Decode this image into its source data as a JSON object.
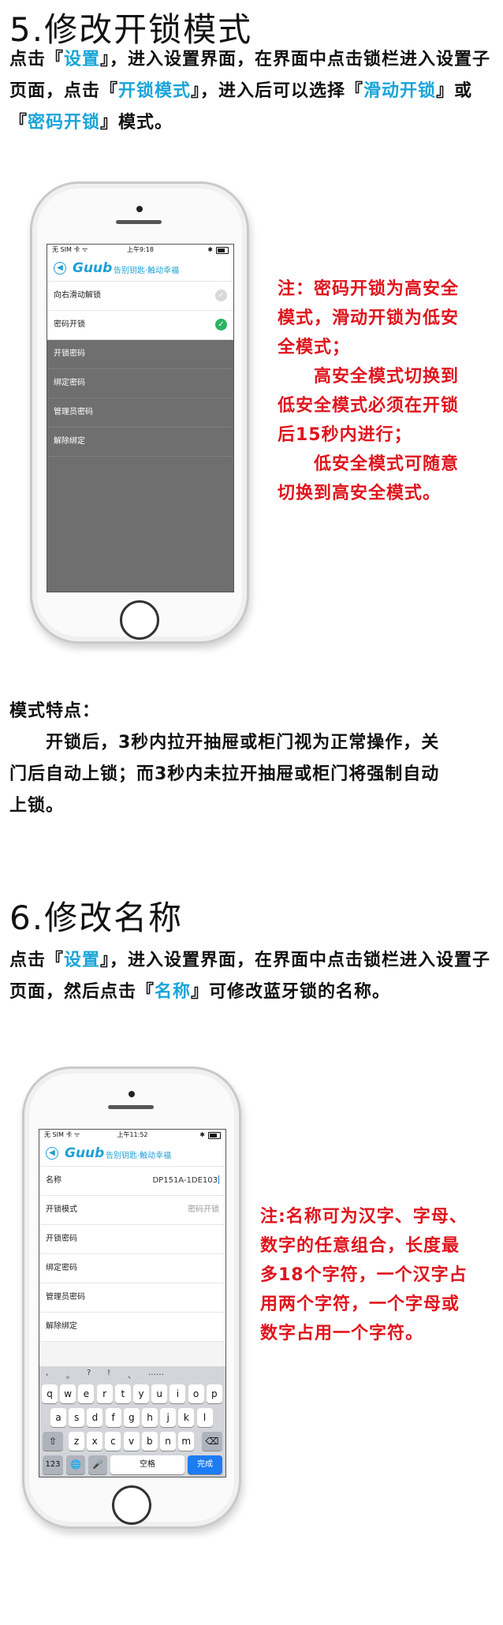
{
  "section5": {
    "heading": "5.修改开锁模式",
    "intro": [
      {
        "t": "点击『",
        "c": ""
      },
      {
        "t": "设置",
        "c": "blue"
      },
      {
        "t": "』，进入设置界面，在界面中点击锁栏进入设置子页面，点击『",
        "c": ""
      },
      {
        "t": "开锁模式",
        "c": "blue"
      },
      {
        "t": "』，进入后可以选择『",
        "c": ""
      },
      {
        "t": "滑动开锁",
        "c": "blue"
      },
      {
        "t": "』或『",
        "c": ""
      },
      {
        "t": "密码开锁",
        "c": "blue"
      },
      {
        "t": "』模式。",
        "c": ""
      }
    ],
    "note_lines": [
      "注：密码开锁为高安全",
      "模式，滑动开锁为低安",
      "全模式；",
      "　　高安全模式切换到",
      "低安全模式必须在开锁",
      "后15秒内进行；",
      "　　低安全模式可随意",
      "切换到高安全模式。"
    ],
    "features_title": "模式特点：",
    "features_lines": [
      "　　开锁后，3秒内拉开抽屉或柜门视为正常操作，关",
      "门后自动上锁；而3秒内未拉开抽屉或柜门将强制自动",
      "上锁。"
    ]
  },
  "phone1": {
    "carrier": "无 SIM 卡 ᯤ",
    "time": "上午9:18",
    "bt": "✱",
    "logo": "Guub",
    "slogan": "告别钥匙·触动幸福",
    "rows": [
      {
        "label": "向右滑动解锁",
        "checked": false
      },
      {
        "label": "密码开锁",
        "checked": true
      }
    ],
    "menu": [
      "开锁密码",
      "绑定密码",
      "管理员密码",
      "解除绑定"
    ]
  },
  "section6": {
    "heading": "6.修改名称",
    "intro": [
      {
        "t": "点击『",
        "c": ""
      },
      {
        "t": "设置",
        "c": "blue"
      },
      {
        "t": "』，进入设置界面，在界面中点击锁栏进入设置子页面，然后点击『",
        "c": ""
      },
      {
        "t": "名称",
        "c": "blue"
      },
      {
        "t": "』可修改蓝牙锁的名称。",
        "c": ""
      }
    ],
    "note_lines": [
      "注:名称可为汉字、字母、",
      "数字的任意组合，长度最",
      "多18个字符，一个汉字占",
      "用两个字符，一个字母或",
      "数字占用一个字符。"
    ]
  },
  "phone2": {
    "carrier": "无 SIM 卡 ᯤ",
    "time": "上午11:52",
    "bt": "✱",
    "logo": "Guub",
    "slogan": "告别钥匙·触动幸福",
    "name_label": "名称",
    "name_value": "DP151A-1DE103",
    "mode_label": "开锁模式",
    "mode_value": "密码开锁",
    "menu": [
      "开锁密码",
      "绑定密码",
      "管理员密码",
      "解除绑定"
    ],
    "suggestions": [
      ",",
      "。",
      "?",
      "!",
      "、",
      "……"
    ],
    "keys_row1": [
      "q",
      "w",
      "e",
      "r",
      "t",
      "y",
      "u",
      "i",
      "o",
      "p"
    ],
    "keys_row2": [
      "a",
      "s",
      "d",
      "f",
      "g",
      "h",
      "j",
      "k",
      "l"
    ],
    "keys_row3": [
      "z",
      "x",
      "c",
      "v",
      "b",
      "n",
      "m"
    ],
    "shift": "⇧",
    "delete": "⌫",
    "num_key": "123",
    "globe": "🌐",
    "mic": "🎤",
    "space": "空格",
    "done": "完成"
  }
}
